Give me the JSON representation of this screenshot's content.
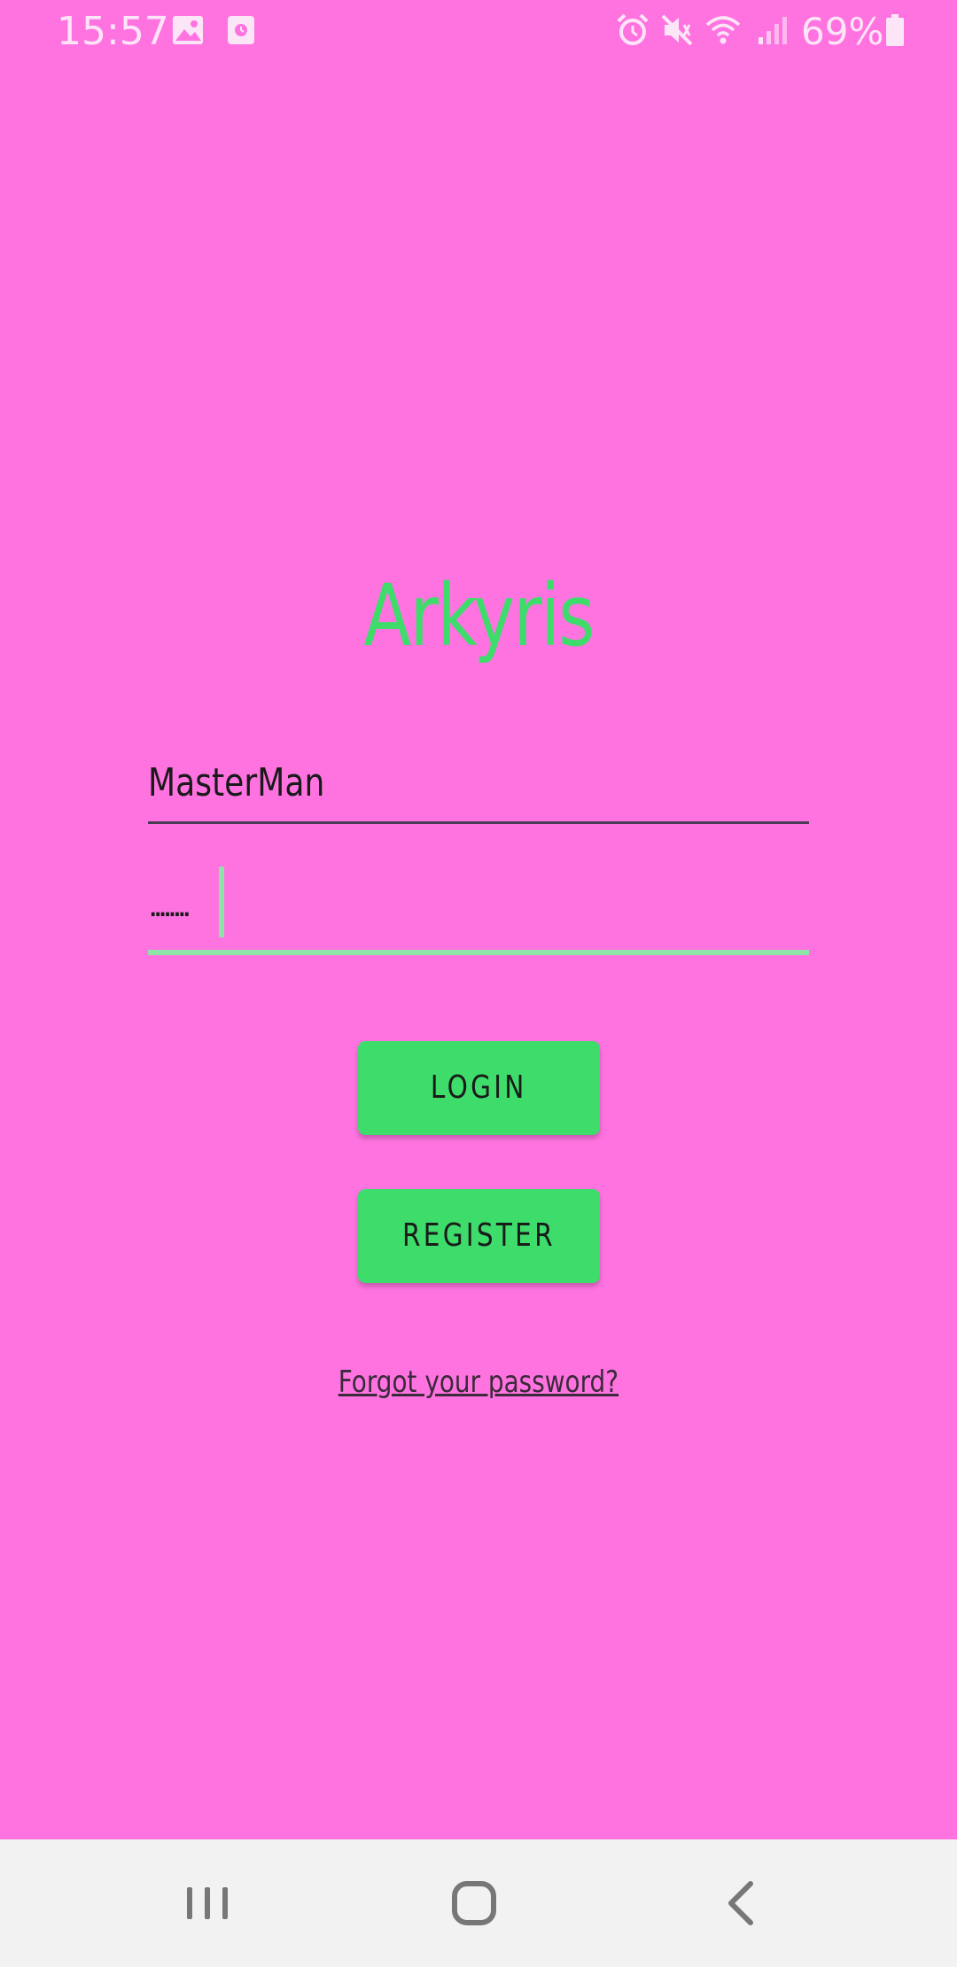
{
  "status_bar": {
    "time": "15:57",
    "left_icons": [
      "gallery-icon",
      "screen-recorder-icon"
    ],
    "right_icons": [
      "alarm-icon",
      "mute-icon",
      "wifi-icon",
      "signal-icon",
      "battery-icon"
    ],
    "battery_text": "69%"
  },
  "login": {
    "app_title": "Arkyris",
    "username_value": "MasterMan",
    "password_value": "........",
    "login_label": "LOGIN",
    "register_label": "REGISTER",
    "forgot_label": "Forgot your password?"
  },
  "nav_bar": {
    "buttons": [
      "recent-apps-icon",
      "home-icon",
      "back-icon"
    ]
  },
  "colors": {
    "background": "#FF73E1",
    "accent": "#3DDC6B",
    "focused_underline": "#8FE3A6",
    "navigation_bar": "#F2F2F2"
  }
}
